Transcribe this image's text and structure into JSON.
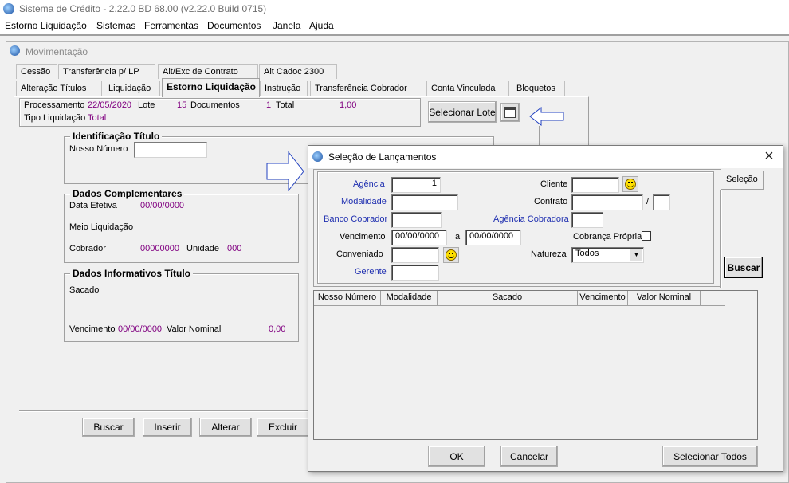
{
  "app": {
    "title": "Sistema de Crédito - 2.22.0 BD 68.00 (v2.22.0 Build 0715)"
  },
  "menu": [
    "Estorno Liquidação",
    "Sistemas",
    "Ferramentas",
    "Documentos",
    "Janela",
    "Ajuda"
  ],
  "child": {
    "title": "Movimentação"
  },
  "tabs_row1": [
    "Cessão",
    "Transferência p/ LP",
    "Alt/Exc de Contrato",
    "Alt Cadoc 2300"
  ],
  "tabs_row2": [
    "Alteração Títulos",
    "Liquidação",
    "Estorno Liquidação",
    "Instrução",
    "Transferência Cobrador",
    "Conta Vinculada",
    "Bloquetos"
  ],
  "header": {
    "processamento_label": "Processamento",
    "processamento_value": "22/05/2020",
    "lote_label": "Lote",
    "lote_value": "15",
    "documentos_label": "Documentos",
    "documentos_value": "1",
    "total_label": "Total",
    "total_value": "1,00",
    "tipo_label": "Tipo Liquidação",
    "tipo_value": "Total",
    "selecionar_lote": "Selecionar Lote"
  },
  "ident": {
    "title": "Identificação Título",
    "nosso_numero_label": "Nosso Número",
    "nosso_numero_value": ""
  },
  "complementares": {
    "title": "Dados Complementares",
    "data_efetiva_label": "Data Efetiva",
    "data_efetiva_value": "00/00/0000",
    "meio_label": "Meio Liquidação",
    "cobrador_label": "Cobrador",
    "cobrador_value": "00000000",
    "unidade_label": "Unidade",
    "unidade_value": "000"
  },
  "informativos": {
    "title": "Dados Informativos Título",
    "sacado_label": "Sacado",
    "vencimento_label": "Vencimento",
    "vencimento_value": "00/00/0000",
    "valor_label": "Valor Nominal",
    "valor_value": "0,00"
  },
  "bottom_buttons": [
    "Buscar",
    "Inserir",
    "Alterar",
    "Excluir"
  ],
  "dialog": {
    "title": "Seleção de Lançamentos",
    "tab": "Seleção",
    "agencia_label": "Agência",
    "agencia_value": "1",
    "modalidade_label": "Modalidade",
    "banco_label": "Banco Cobrador",
    "vencimento_label": "Vencimento",
    "venc_de": "00/00/0000",
    "a_label": "a",
    "venc_ate": "00/00/0000",
    "conveniado_label": "Conveniado",
    "gerente_label": "Gerente",
    "cliente_label": "Cliente",
    "contrato_label": "Contrato",
    "contrato_sep": "/",
    "agencia_cobradora_label": "Agência Cobradora",
    "cobranca_propria_label": "Cobrança Própria",
    "natureza_label": "Natureza",
    "natureza_value": "Todos",
    "buscar": "Buscar",
    "columns": [
      "Nosso Número",
      "Modalidade",
      "Sacado",
      "Vencimento",
      "Valor Nominal"
    ],
    "ok": "OK",
    "cancelar": "Cancelar",
    "selecionar_todos": "Selecionar Todos"
  },
  "colors": {
    "link_blue": "#1f2fb0",
    "value_purple": "#800080"
  }
}
